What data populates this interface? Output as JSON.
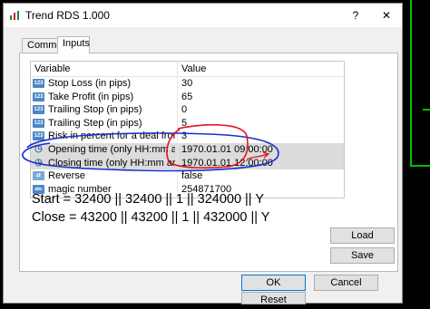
{
  "window": {
    "title": "Trend RDS 1.000",
    "help_symbol": "?",
    "close_symbol": "✕"
  },
  "tabs": [
    {
      "label": "Common",
      "active": false
    },
    {
      "label": "Inputs",
      "active": true
    }
  ],
  "grid": {
    "headers": {
      "variable": "Variable",
      "value": "Value"
    },
    "rows": [
      {
        "icon": "123",
        "name": "Stop Loss (in pips)",
        "value": "30"
      },
      {
        "icon": "123",
        "name": "Take Profit (in pips)",
        "value": "65"
      },
      {
        "icon": "123",
        "name": "Trailing Stop (in pips)",
        "value": "0"
      },
      {
        "icon": "123",
        "name": "Trailing Step (in pips)",
        "value": "5"
      },
      {
        "icon": "123",
        "name": "Risk in percent for a deal from a free ma...",
        "value": "3"
      },
      {
        "icon": "clock",
        "name": "Opening time (only HH:mm are considered)",
        "value": "1970.01.01 09:00:00"
      },
      {
        "icon": "clock",
        "name": "Closing time (only HH:mm are considered)",
        "value": "1970.01.01 12:00:00"
      },
      {
        "icon": "bool",
        "name": "Reverse",
        "value": "false"
      },
      {
        "icon": "abc",
        "name": "magic number",
        "value": "254871700"
      }
    ]
  },
  "notes": {
    "start": "Start = 32400 || 32400 || 1 || 324000 || Y",
    "close": "Close = 43200 || 43200 || 1 || 432000 || Y"
  },
  "buttons": {
    "load": "Load",
    "save": "Save",
    "ok": "OK",
    "cancel": "Cancel",
    "reset": "Reset"
  },
  "colors": {
    "annotation_blue": "#1a2fd0",
    "annotation_red": "#e0141e",
    "chart_line": "#00c000",
    "selection": "#dcdcdc"
  }
}
